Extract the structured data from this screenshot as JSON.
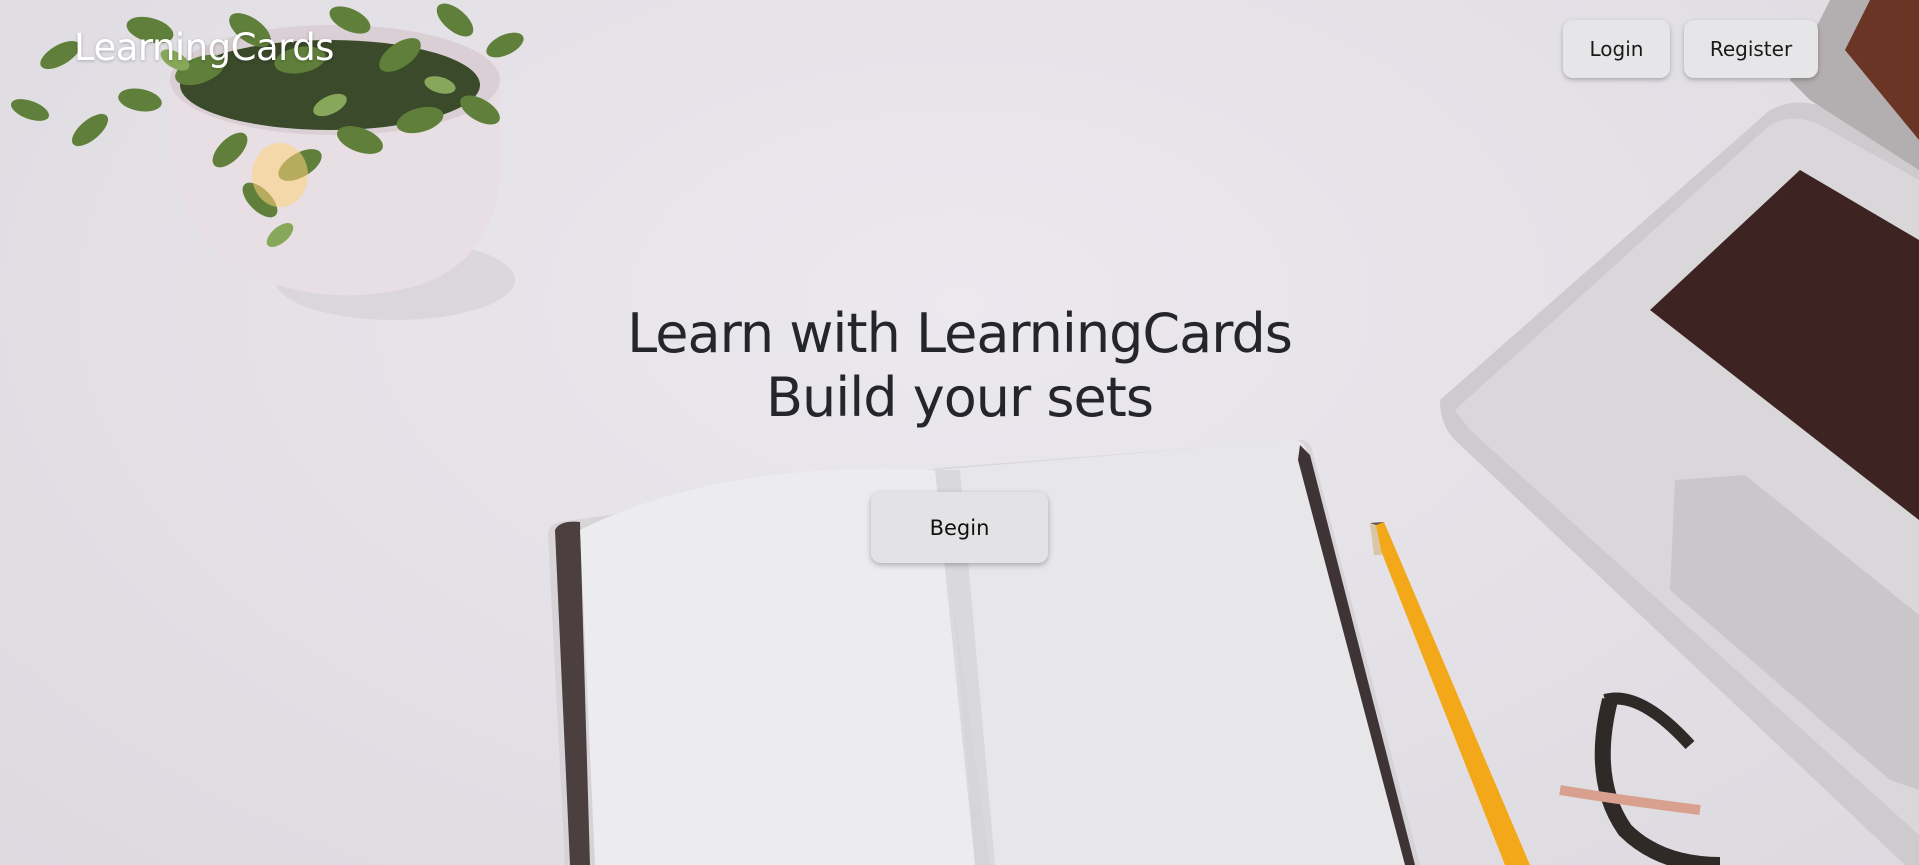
{
  "header": {
    "brand": "LearningCards",
    "login_label": "Login",
    "register_label": "Register"
  },
  "hero": {
    "line1": "Learn with LearningCards",
    "line2": "Build your sets",
    "begin_label": "Begin"
  },
  "colors": {
    "background": "#e4e2e7",
    "button_bg": "#e6e6e8",
    "heading_text": "#24262b",
    "brand_text": "#ffffff",
    "pencil": "#f3a81a",
    "keyboard_keys": "#3d2322"
  }
}
